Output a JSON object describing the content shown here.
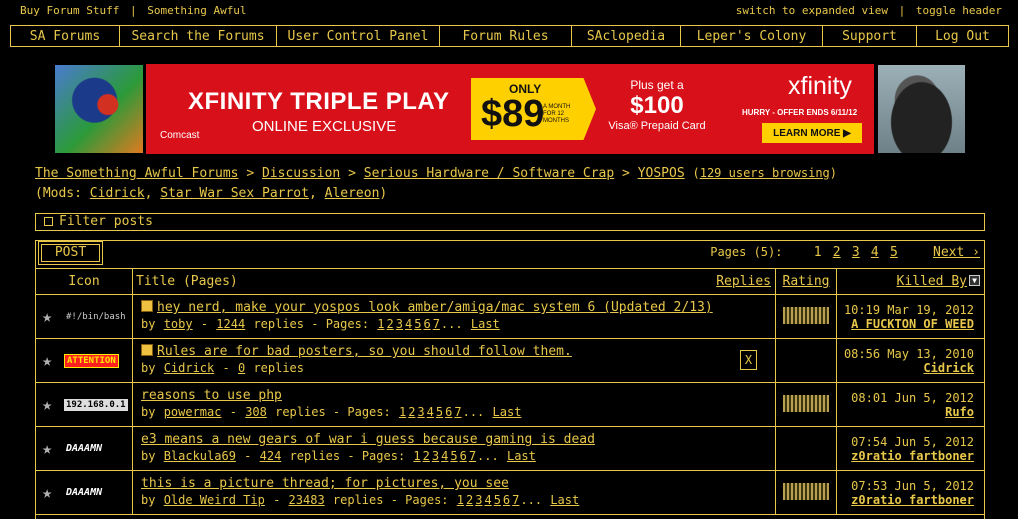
{
  "top": {
    "left_links": [
      "Buy Forum Stuff",
      "Something Awful"
    ],
    "separator": "|",
    "right_links": [
      "switch to expanded view",
      "toggle header"
    ]
  },
  "nav": [
    "SA Forums",
    "Search the Forums",
    "User Control Panel",
    "Forum Rules",
    "SAclopedia",
    "Leper's Colony",
    "Support",
    "Log Out"
  ],
  "ad": {
    "title": "XFINITY TRIPLE PLAY",
    "subtitle": "ONLINE EXCLUSIVE",
    "comcast": "Comcast",
    "only": "ONLY",
    "price": "$89",
    "price_note": "A MONTH FOR 12 MONTHS",
    "plus": "Plus get a",
    "bonus": "$100",
    "bonus_note": "Visa® Prepaid Card",
    "brand": "xfinity",
    "hurry": "HURRY - OFFER ENDS 6/11/12",
    "learn": "LEARN MORE ▶"
  },
  "breadcrumb": {
    "items": [
      "The Something Awful Forums",
      "Discussion",
      "Serious Hardware / Software Crap",
      "YOSPOS"
    ],
    "sep": ">",
    "browsing": "129 users browsing"
  },
  "mods": {
    "prefix": "(Mods:",
    "names": [
      "Cidrick",
      "Star War Sex Parrot",
      "Alereon"
    ],
    "suffix": ")"
  },
  "filter_label": "Filter posts",
  "post_button": "POST",
  "pagination": {
    "label": "Pages (5):",
    "pages": [
      "1",
      "2",
      "3",
      "4",
      "5"
    ],
    "next": "Next ›"
  },
  "columns": {
    "icon": "Icon",
    "title": "Title (Pages)",
    "replies": "Replies",
    "rating": "Rating",
    "killed_by": "Killed By"
  },
  "threads": [
    {
      "icon_text": "#!/bin/bash",
      "title": "hey nerd, make your yospos look amber/amiga/mac system 6 (Updated 2/13)",
      "author": "toby",
      "replies": "1244",
      "pages": [
        "1",
        "2",
        "3",
        "4",
        "5",
        "6",
        "7"
      ],
      "last_label": "Last",
      "time": "10:19 Mar 19, 2012",
      "killed_by": "A FUCKTON OF WEED"
    },
    {
      "icon_text": "ATTENTION",
      "title": "Rules are for bad posters, so you should follow them.",
      "author": "Cidrick",
      "replies": "0",
      "close": "X",
      "time": "08:56 May 13, 2010",
      "killed_by": "Cidrick"
    },
    {
      "icon_text": "192.168.0.1",
      "title": "reasons to use php",
      "author": "powermac",
      "replies": "308",
      "pages": [
        "1",
        "2",
        "3",
        "4",
        "5",
        "6",
        "7"
      ],
      "last_label": "Last",
      "time": "08:01 Jun 5, 2012",
      "killed_by": "Rufo"
    },
    {
      "icon_text": "DAAAMN",
      "title": "e3 means a new gears of war i guess because gaming is dead",
      "author": "Blackula69",
      "replies": "424",
      "pages": [
        "1",
        "2",
        "3",
        "4",
        "5",
        "6",
        "7"
      ],
      "last_label": "Last",
      "time": "07:54 Jun 5, 2012",
      "killed_by": "z0ratio fartboner"
    },
    {
      "icon_text": "DAAAMN",
      "title": "this is a picture thread; for pictures, you see",
      "author": "Olde Weird Tip",
      "replies": "23483",
      "pages": [
        "1",
        "2",
        "3",
        "4",
        "5",
        "6",
        "7"
      ],
      "last_label": "Last",
      "time": "07:53 Jun 5, 2012",
      "killed_by": "z0ratio fartboner"
    }
  ],
  "labels": {
    "by": "by",
    "dash": "-",
    "replies_word": "replies",
    "pages_word": "- Pages:",
    "ellipsis": "..."
  }
}
